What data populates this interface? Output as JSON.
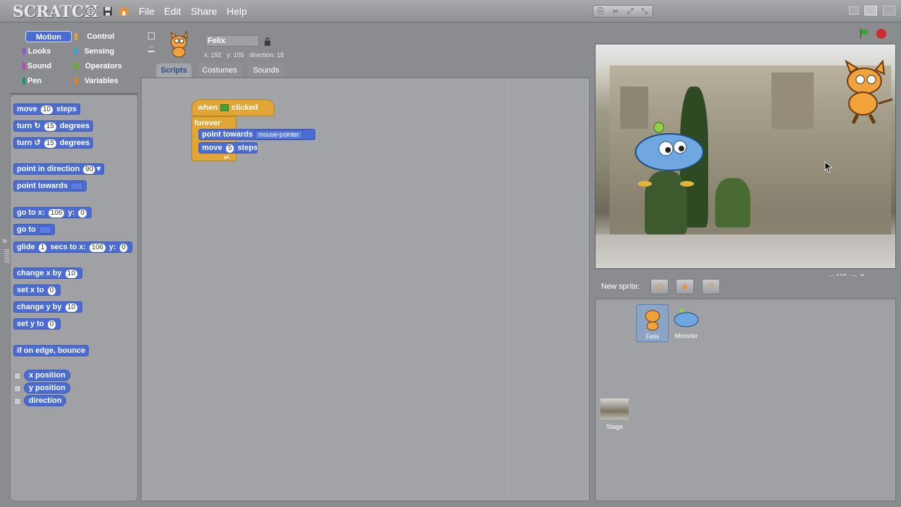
{
  "app": {
    "logo_text": "SCRATCH"
  },
  "menu": {
    "file": "File",
    "edit": "Edit",
    "share": "Share",
    "help": "Help"
  },
  "categories": [
    {
      "label": "Motion",
      "color": "#4a6cd4"
    },
    {
      "label": "Control",
      "color": "#e1a636"
    },
    {
      "label": "Looks",
      "color": "#8a55d7"
    },
    {
      "label": "Sensing",
      "color": "#2ca5e2"
    },
    {
      "label": "Sound",
      "color": "#bb42c3"
    },
    {
      "label": "Operators",
      "color": "#5cb712"
    },
    {
      "label": "Pen",
      "color": "#0e9a6c"
    },
    {
      "label": "Variables",
      "color": "#ee7d16"
    }
  ],
  "palette": {
    "move": {
      "a": "move",
      "n": "10",
      "b": "steps"
    },
    "turn_cw": {
      "a": "turn",
      "sym": "↻",
      "n": "15",
      "b": "degrees"
    },
    "turn_ccw": {
      "a": "turn",
      "sym": "↺",
      "n": "15",
      "b": "degrees"
    },
    "point_dir": {
      "a": "point in direction",
      "n": "90"
    },
    "point_towards": {
      "a": "point towards"
    },
    "goto_xy": {
      "a": "go to x:",
      "x": "106",
      "b": "y:",
      "y": "0"
    },
    "goto": {
      "a": "go to"
    },
    "glide": {
      "a": "glide",
      "n": "1",
      "b": "secs to x:",
      "x": "106",
      "c": "y:",
      "y": "0"
    },
    "change_x": {
      "a": "change x by",
      "n": "10"
    },
    "set_x": {
      "a": "set x to",
      "n": "0"
    },
    "change_y": {
      "a": "change y by",
      "n": "10"
    },
    "set_y": {
      "a": "set y to",
      "n": "0"
    },
    "bounce": {
      "a": "if on edge, bounce"
    },
    "reporters": [
      "x position",
      "y position",
      "direction"
    ]
  },
  "sprite": {
    "name": "Felix",
    "x_label": "x:",
    "x": "192",
    "y_label": "y:",
    "y": "105",
    "dir_label": "direction:",
    "direction": "18"
  },
  "tabs": [
    "Scripts",
    "Costumes",
    "Sounds"
  ],
  "script": {
    "when": "when",
    "clicked": "clicked",
    "forever": "forever",
    "point_towards": "point towards",
    "target": "mouse-pointer",
    "move": "move",
    "steps_n": "5",
    "steps": "steps"
  },
  "stage": {
    "coords_x": "x: 127",
    "coords_y": "y: -8"
  },
  "new_sprite": {
    "label": "New sprite:"
  },
  "sprites": [
    {
      "name": "Felix",
      "selected": true
    },
    {
      "name": "Monster",
      "selected": false
    }
  ],
  "stage_thumb": {
    "label": "Stage"
  },
  "colors": {
    "motion": "#4a6cd4",
    "control": "#e1a636",
    "green_flag": "#3aa33a",
    "stop": "#d42a2a"
  }
}
